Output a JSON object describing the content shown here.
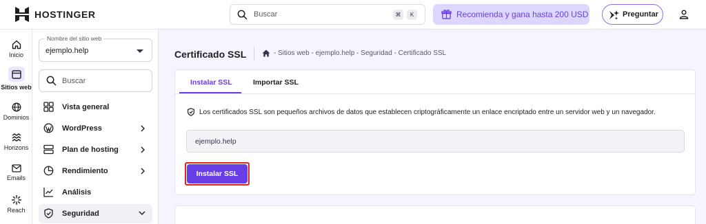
{
  "brand": {
    "name": "HOSTINGER"
  },
  "topbar": {
    "search_placeholder": "Buscar",
    "shortcut_cmd": "⌘",
    "shortcut_k": "K",
    "promo_label": "Recomienda y gana hasta 200 USD",
    "ask_label": "Preguntar"
  },
  "rail": [
    {
      "label": "Inicio",
      "icon": "home-icon"
    },
    {
      "label": "Sitios web",
      "icon": "browser-window-icon",
      "active": true
    },
    {
      "label": "Dominios",
      "icon": "globe-icon"
    },
    {
      "label": "Horizons",
      "icon": "waves-icon"
    },
    {
      "label": "Emails",
      "icon": "mail-icon"
    },
    {
      "label": "Reach",
      "icon": "sparkle-icon"
    }
  ],
  "sidebar": {
    "site_select_legend": "Nombre del sitio web",
    "site_select_value": "ejemplo.help",
    "search_placeholder": "Buscar",
    "items": [
      {
        "label": "Vista general",
        "icon": "grid-icon"
      },
      {
        "label": "WordPress",
        "icon": "wordpress-icon",
        "chevron": "right"
      },
      {
        "label": "Plan de hosting",
        "icon": "server-icon",
        "chevron": "right"
      },
      {
        "label": "Rendimiento",
        "icon": "pie-chart-icon",
        "chevron": "right"
      },
      {
        "label": "Análisis",
        "icon": "analytics-icon"
      },
      {
        "label": "Seguridad",
        "icon": "shield-icon",
        "chevron": "down",
        "active": true
      }
    ]
  },
  "main": {
    "title": "Certificado SSL",
    "breadcrumb": "- Sitios web - ejemplo.help - Seguridad - Certificado SSL",
    "tabs": [
      {
        "label": "Instalar SSL",
        "active": true
      },
      {
        "label": "Importar SSL"
      }
    ],
    "info_text": "Los certificados SSL son pequeños archivos de datos que establecen criptográficamente un enlace encriptado entre un servidor web y un navegador.",
    "domain_value": "ejemplo.help",
    "install_button_label": "Instalar SSL"
  },
  "colors": {
    "accent": "#673de6",
    "promo_bg": "#ddd7ff",
    "highlight_outline": "#e0241c",
    "page_bg": "#f4f5ff"
  }
}
